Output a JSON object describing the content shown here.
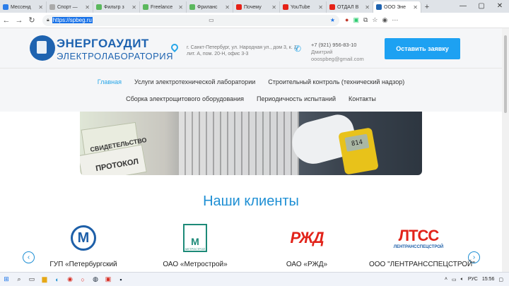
{
  "browser": {
    "tabs": [
      {
        "title": "Мессенд",
        "color": "#2b7de9"
      },
      {
        "title": "Спорт —",
        "color": "#aaaaaa"
      },
      {
        "title": "Фильтр з",
        "color": "#5bb85d"
      },
      {
        "title": "Freelance",
        "color": "#5bb85d"
      },
      {
        "title": "Фриланс",
        "color": "#5bb85d"
      },
      {
        "title": "Почему",
        "color": "#e62117"
      },
      {
        "title": "YouTube",
        "color": "#e62117"
      },
      {
        "title": "ОТДАЛ В",
        "color": "#e62117"
      },
      {
        "title": "ООО Эне",
        "color": "#1e63b0"
      }
    ],
    "url": "https://spbeg.ru",
    "window_controls": [
      "—",
      "▢",
      "✕"
    ]
  },
  "header": {
    "logo_line1": "ЭНЕРГОАУДИТ",
    "logo_line2": "ЭЛЕКТРОЛАБОРАТОРИЯ",
    "address": "г. Санкт-Петербург, ул. Народная ул., дом 3, к. 1, лит. А, пом. 20-Н, офис 3-3",
    "phone": "+7 (921) 956-83-10",
    "contact_name": "Дмитрий",
    "email": "ooospbeg@gmail.com",
    "cta_label": "Оставить заявку"
  },
  "menu": {
    "row1": [
      "Главная",
      "Услуги электротехнической лаборатории",
      "Строительный контроль (технический надзор)"
    ],
    "row2": [
      "Сборка электрощитового оборудования",
      "Периодичность испытаний",
      "Контакты"
    ]
  },
  "banner": {
    "doc1": "СВИДЕТЕЛЬСТВО",
    "doc2": "ПРОТОКОЛ",
    "meter_reading": "814"
  },
  "clients": {
    "title": "Наши клиенты",
    "items": [
      {
        "name": "ГУП «Петербургский",
        "logo": "М"
      },
      {
        "name": "ОАО «Метрострой»",
        "logo": "М",
        "logo_caption": "МЕТРОСТРОЙ"
      },
      {
        "name": "ОАО «РЖД»",
        "logo": "РЖД"
      },
      {
        "name": "ООО \"ЛЕНТРАНССПЕЦСТРОЙ\"",
        "logo": "ЛТСС",
        "logo_caption": "ЛЕНТРАНССПЕЦСТРОЙ"
      }
    ]
  },
  "taskbar": {
    "lang": "РУС",
    "time": "15:56"
  }
}
